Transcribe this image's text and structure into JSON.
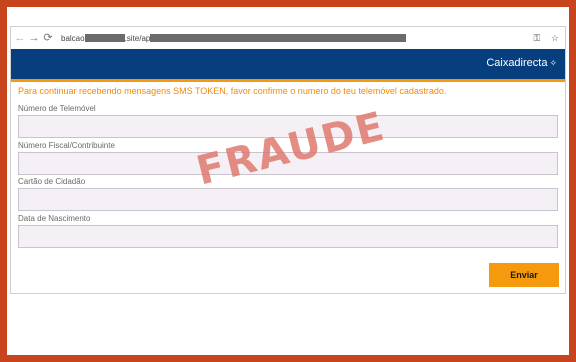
{
  "browser": {
    "url_prefix": "balcao",
    "url_middle": ".site/ap",
    "back_icon": "arrow-left-icon",
    "forward_icon": "arrow-right-icon",
    "reload_icon": "reload-icon",
    "key_icon": "key-icon",
    "star_icon": "star-icon"
  },
  "header": {
    "brand": "Caixadirecta",
    "brand_logo_glyph": "✧",
    "bg_color": "#063e7e",
    "accent_color": "#f49a0c"
  },
  "form": {
    "message": "Para continuar recebendo mensagens SMS TOKEN, favor confirme o numero do teu telemóvel cadastrado.",
    "fields": [
      {
        "label": "Número de Telemóvel",
        "value": ""
      },
      {
        "label": "Número Fiscal/Contribuinte",
        "value": ""
      },
      {
        "label": "Cartão de Cidadão",
        "value": ""
      },
      {
        "label": "Data de Nascimento",
        "value": ""
      }
    ],
    "submit_label": "Enviar"
  },
  "overlay": {
    "stamp_text": "FRAUDE",
    "stamp_color": "#e07a6e",
    "frame_color": "#c8441c"
  }
}
